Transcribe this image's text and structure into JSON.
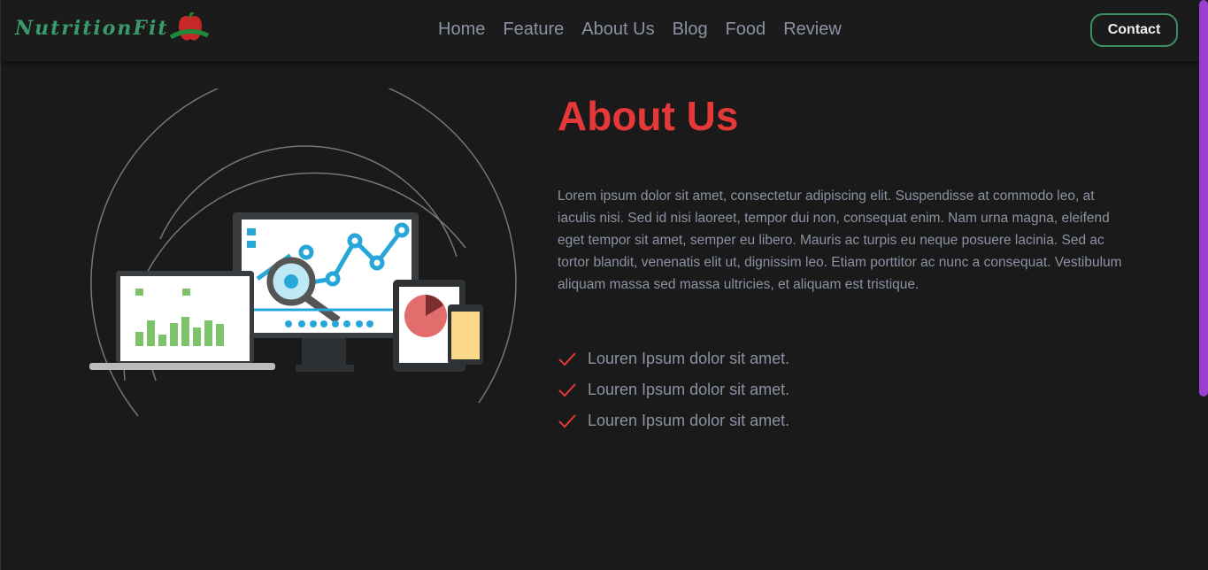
{
  "brand": {
    "name": "NutritionFit"
  },
  "nav": {
    "items": [
      "Home",
      "Feature",
      "About Us",
      "Blog",
      "Food",
      "Review"
    ],
    "contact": "Contact"
  },
  "about": {
    "title": "About Us",
    "paragraph": "Lorem ipsum dolor sit amet, consectetur adipiscing elit. Suspendisse at commodo leo, at iaculis nisi. Sed id nisi laoreet, tempor dui non, consequat enim. Nam urna magna, eleifend eget tempor sit amet, semper eu libero. Mauris ac turpis eu neque posuere lacinia. Sed ac tortor blandit, venenatis elit ut, dignissim leo. Etiam porttitor ac nunc a consequat. Vestibulum aliquam massa sed massa ultricies, et aliquam est tristique.",
    "checks": [
      "Louren Ipsum dolor sit amet.",
      "Louren Ipsum dolor sit amet.",
      "Louren Ipsum dolor sit amet."
    ]
  },
  "colors": {
    "accent": "#e53838",
    "green": "#3d8f63",
    "scrollbar": "#9a3fd0"
  }
}
